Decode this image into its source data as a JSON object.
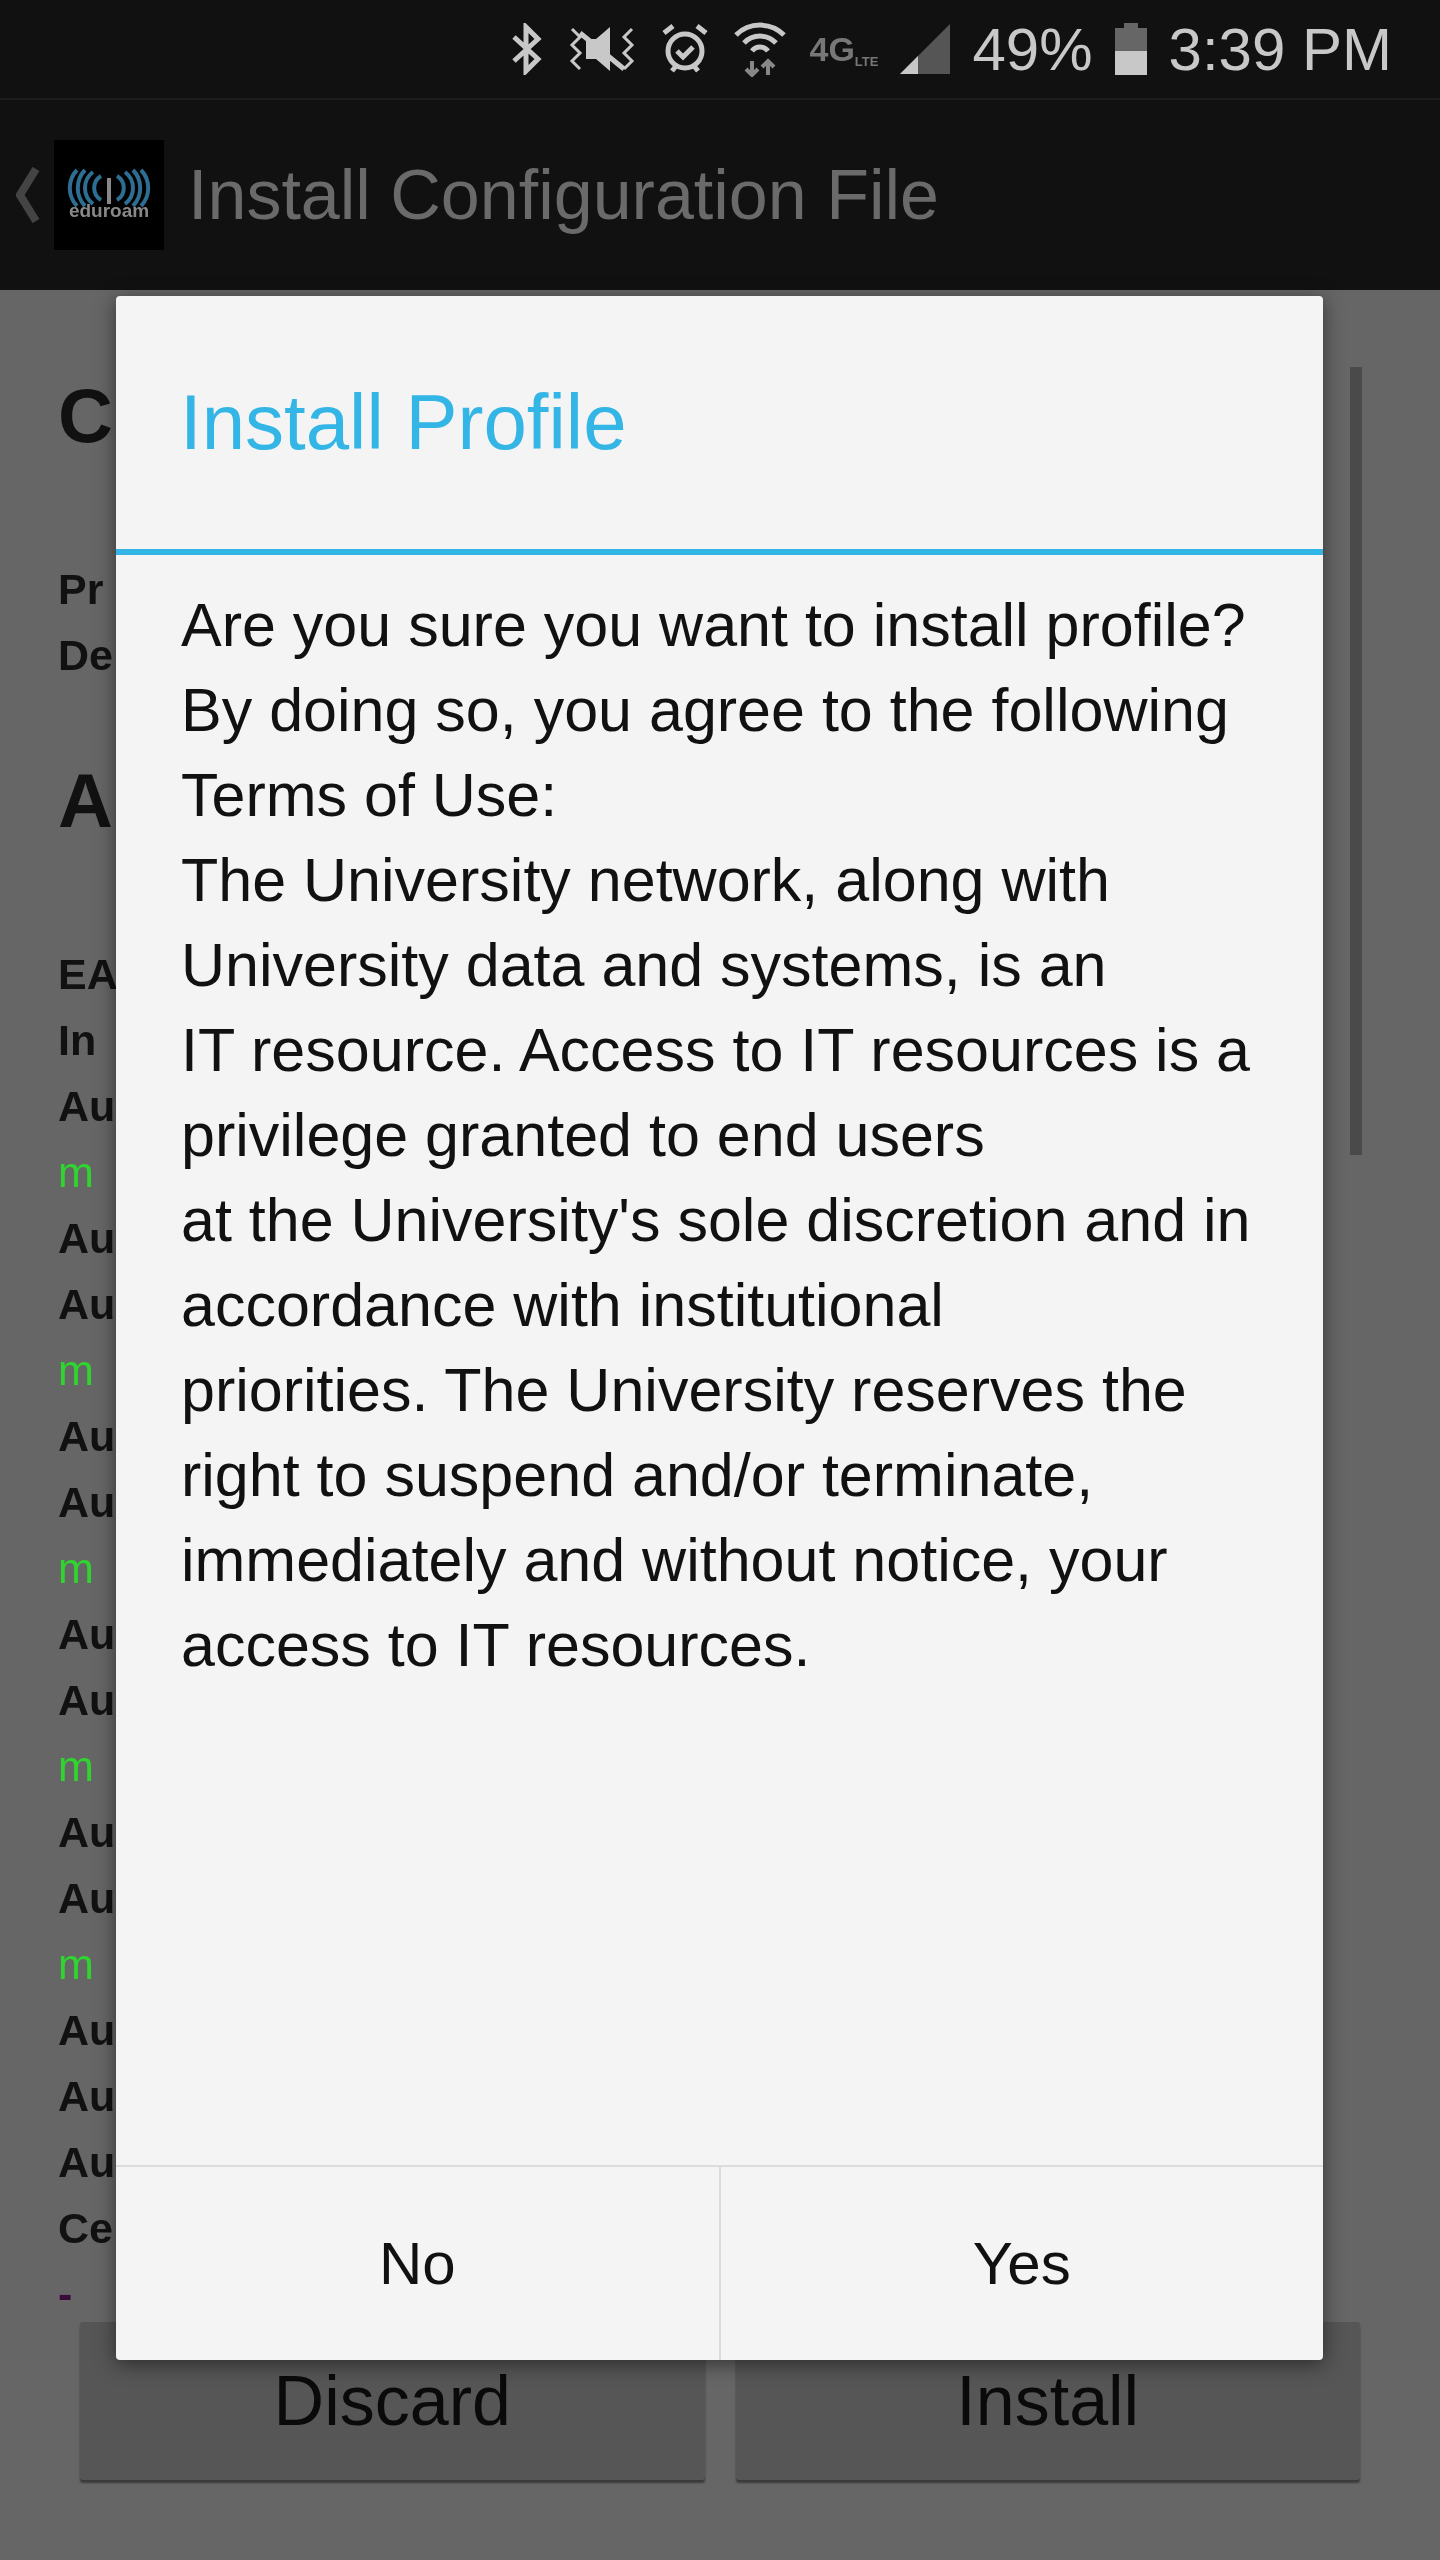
{
  "status_bar": {
    "network": "4G",
    "network_sub": "LTE",
    "battery": "49%",
    "time": "3:39 PM"
  },
  "action_bar": {
    "logo_text": "eduroam",
    "title": "Install Configuration File"
  },
  "background_lines": [
    {
      "kind": "heading",
      "text": "C"
    },
    {
      "kind": "label",
      "text": "Pr"
    },
    {
      "kind": "label",
      "text": "De"
    },
    {
      "kind": "heading",
      "text": "A"
    },
    {
      "kind": "label",
      "text": "EA"
    },
    {
      "kind": "label",
      "text": "In"
    },
    {
      "kind": "label",
      "text": "Au"
    },
    {
      "kind": "value",
      "text": "m"
    },
    {
      "kind": "label",
      "text": "Au"
    },
    {
      "kind": "label",
      "text": "Au"
    },
    {
      "kind": "value",
      "text": "m"
    },
    {
      "kind": "label",
      "text": "Au"
    },
    {
      "kind": "label",
      "text": "Au"
    },
    {
      "kind": "value",
      "text": "m"
    },
    {
      "kind": "label",
      "text": "Au"
    },
    {
      "kind": "label",
      "text": "Au"
    },
    {
      "kind": "value",
      "text": "m"
    },
    {
      "kind": "label",
      "text": "Au"
    },
    {
      "kind": "label",
      "text": "Au"
    },
    {
      "kind": "value",
      "text": "m"
    },
    {
      "kind": "label",
      "text": "Au"
    },
    {
      "kind": "label",
      "text": "Au"
    },
    {
      "kind": "label",
      "text": "Au"
    },
    {
      "kind": "label",
      "text": "Ce"
    },
    {
      "kind": "item",
      "text": "-"
    }
  ],
  "page_buttons": [
    "Discard",
    "Install"
  ],
  "dialog": {
    "title": "Install Profile",
    "message": "Are you sure you want to install profile?\nBy doing so, you agree to the following Terms of Use:\nThe University network, along with University data and systems, is an\nIT resource. Access to IT resources is a privilege granted to end users\nat the University's sole discretion and in accordance with institutional\npriorities. The University reserves the right to suspend and/or terminate,\nimmediately and without notice, your access to IT resources.",
    "buttons": [
      "No",
      "Yes"
    ]
  }
}
